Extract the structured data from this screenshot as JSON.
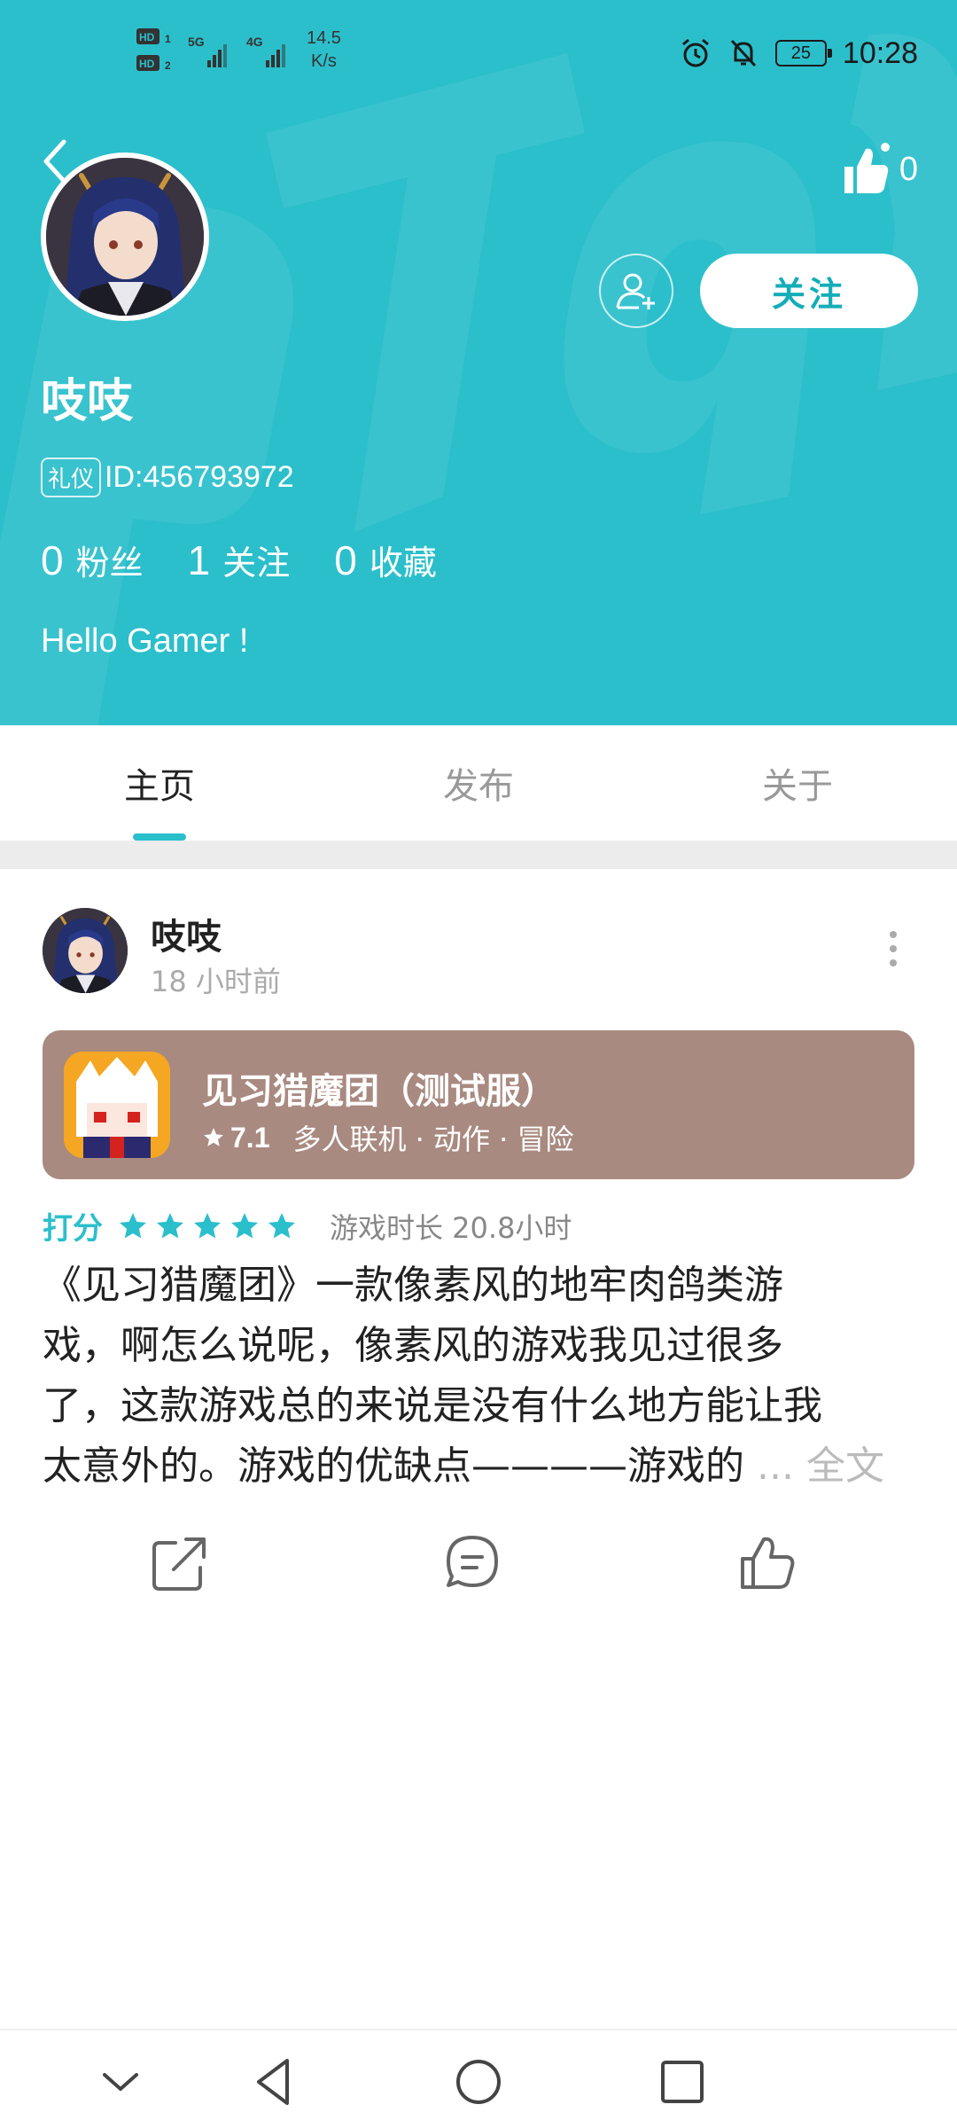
{
  "status_bar": {
    "network_speed_value": "14.5",
    "network_speed_unit": "K/s",
    "sim1_label": "HD",
    "sim2_label": "HD",
    "signal1": "5G",
    "signal2": "4G",
    "battery": "25",
    "time": "10:28",
    "icons": [
      "alarm-icon",
      "mute-icon",
      "battery-icon"
    ]
  },
  "header": {
    "bg_color": "#2bbfcb",
    "like_count": "0",
    "follow_label": "关注",
    "username": "吱吱",
    "badge": "礼仪",
    "user_id": "ID:456793972",
    "stats": [
      {
        "value": "0",
        "label": "粉丝"
      },
      {
        "value": "1",
        "label": "关注"
      },
      {
        "value": "0",
        "label": "收藏"
      }
    ],
    "bio": "Hello Gamer !"
  },
  "tabs": [
    {
      "label": "主页",
      "active": true
    },
    {
      "label": "发布",
      "active": false
    },
    {
      "label": "关于",
      "active": false
    }
  ],
  "post": {
    "author": "吱吱",
    "time": "18 小时前",
    "game": {
      "title": "见习猎魔团（测试服）",
      "score": "7.1",
      "tags": "多人联机 · 动作 · 冒险",
      "card_color": "#a98a80"
    },
    "rating_label": "打分",
    "stars": 5,
    "playtime": "游戏时长 20.8小时",
    "review_lines": [
      "《见习猎魔团》一款像素风的地牢肉鸽类游",
      "戏，啊怎么说呢，像素风的游戏我见过很多",
      "了，这款游戏总的来说是没有什么地方能让我",
      "太意外的。游戏的优缺点————游戏的"
    ],
    "ellipsis": " ...",
    "more_label": " 全文"
  },
  "accent_color": "#2bbfcb"
}
